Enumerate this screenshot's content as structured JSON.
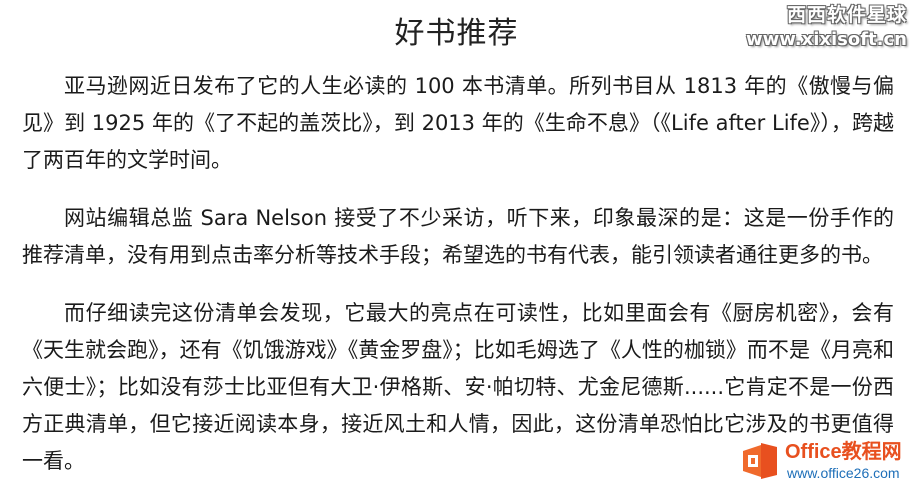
{
  "document": {
    "title": "好书推荐",
    "paragraphs": [
      "亚马逊网近日发布了它的人生必读的 100 本书清单。所列书目从 1813 年的《傲慢与偏见》到 1925 年的《了不起的盖茨比》，到 2013 年的《生命不息》（《Life after Life》），跨越了两百年的文学时间。",
      "网站编辑总监 Sara Nelson 接受了不少采访，听下来，印象最深的是：这是一份手作的推荐清单，没有用到点击率分析等技术手段；希望选的书有代表，能引领读者通往更多的书。",
      "而仔细读完这份清单会发现，它最大的亮点在可读性，比如里面会有《厨房机密》，会有《天生就会跑》，还有《饥饿游戏》《黄金罗盘》；比如毛姆选了《人性的枷锁》而不是《月亮和六便士》；比如没有莎士比亚但有大卫·伊格斯、安·帕切特、尤金尼德斯......它肯定不是一份西方正典清单，但它接近阅读本身，接近风土和人情，因此，这份清单恐怕比它涉及的书更值得一看。"
    ]
  },
  "watermarks": {
    "top_line1": "西西软件星球",
    "top_line2": "www.xixisoft.cn",
    "bottom_brand": "Office教程网",
    "bottom_site": "www.office26.com",
    "bottom_icon": "office-logo-icon",
    "brand_color": "#e8501f",
    "site_color": "#1e6fb8"
  }
}
